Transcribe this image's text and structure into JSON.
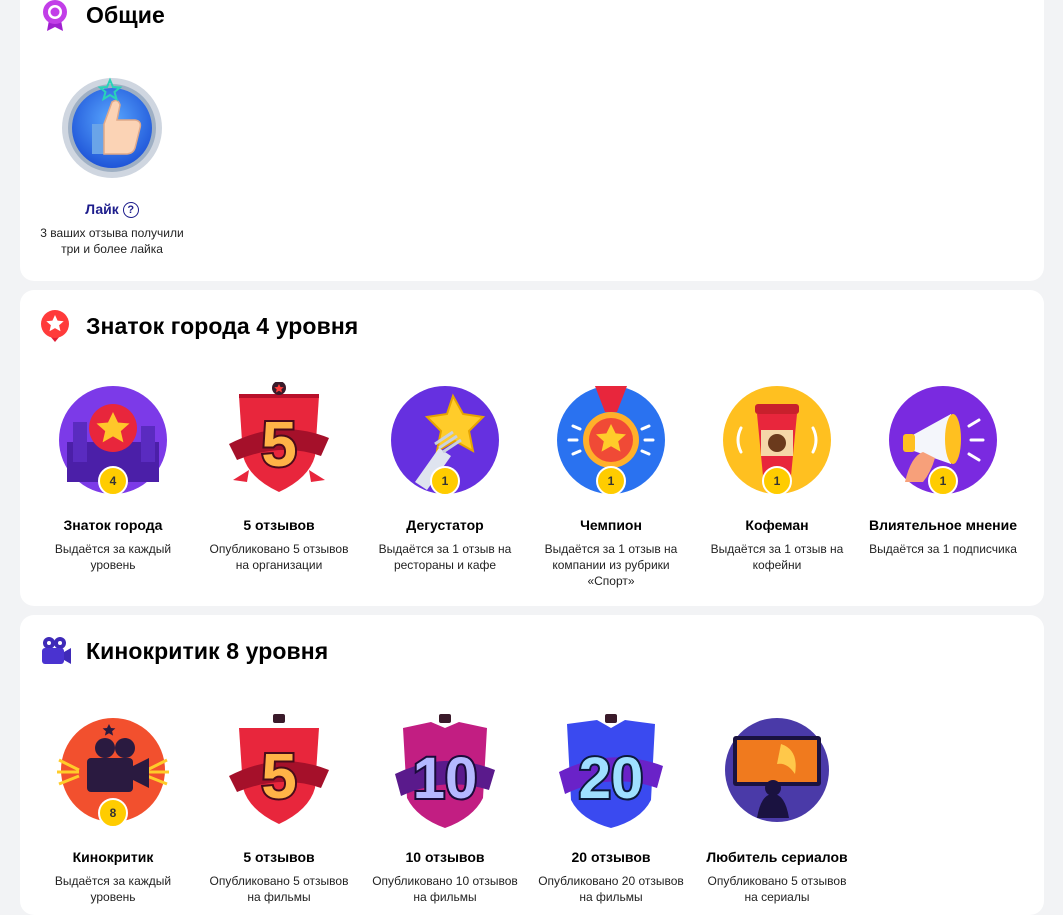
{
  "sections": [
    {
      "title": "Общие",
      "icon": "ribbon-badge-icon",
      "badges": [
        {
          "title": "Лайк",
          "help": "?",
          "desc": "3 ваших отзыва получили три и более лайка",
          "icon": "thumbs-up-icon"
        }
      ]
    },
    {
      "title": "Знаток города 4 уровня",
      "icon": "map-pin-star-icon",
      "badges": [
        {
          "title": "Знаток города",
          "desc": "Выдаётся за каждый уровень",
          "level": "4",
          "icon": "city-star-icon"
        },
        {
          "title": "5 отзывов",
          "desc": "Опубликовано 5 отзывов на организации",
          "big": "5",
          "icon": "shield-five-icon"
        },
        {
          "title": "Дегустатор",
          "desc": "Выдаётся за 1 отзыв на рестораны и кафе",
          "level": "1",
          "icon": "fork-star-icon"
        },
        {
          "title": "Чемпион",
          "desc": "Выдаётся за 1 отзыв на компании из рубрики «Спорт»",
          "level": "1",
          "icon": "medal-icon"
        },
        {
          "title": "Кофеман",
          "desc": "Выдаётся за 1 отзыв на кофейни",
          "level": "1",
          "icon": "coffee-cup-icon"
        },
        {
          "title": "Влиятельное мнение",
          "desc": "Выдаётся за 1 подписчика",
          "level": "1",
          "icon": "megaphone-icon"
        }
      ]
    },
    {
      "title": "Кинокритик 8 уровня",
      "icon": "film-camera-icon",
      "badges": [
        {
          "title": "Кинокритик",
          "desc": "Выдаётся за каждый уровень",
          "level": "8",
          "icon": "film-camera-icon"
        },
        {
          "title": "5 отзывов",
          "desc": "Опубликовано 5 отзывов на фильмы",
          "big": "5",
          "icon": "shield-five-icon"
        },
        {
          "title": "10 отзывов",
          "desc": "Опубликовано 10 отзывов на фильмы",
          "big": "10",
          "icon": "shield-ten-icon"
        },
        {
          "title": "20 отзывов",
          "desc": "Опубликовано 20 отзывов на фильмы",
          "big": "20",
          "icon": "shield-twenty-icon"
        },
        {
          "title": "Любитель сериалов",
          "desc": "Опубликовано 5 отзывов на сериалы",
          "icon": "tv-watcher-icon"
        }
      ]
    }
  ],
  "colors": {
    "page_bg": "#f2f3f5",
    "card_bg": "#ffffff",
    "link": "#1d1d8c",
    "coin": "#ffcc00"
  }
}
